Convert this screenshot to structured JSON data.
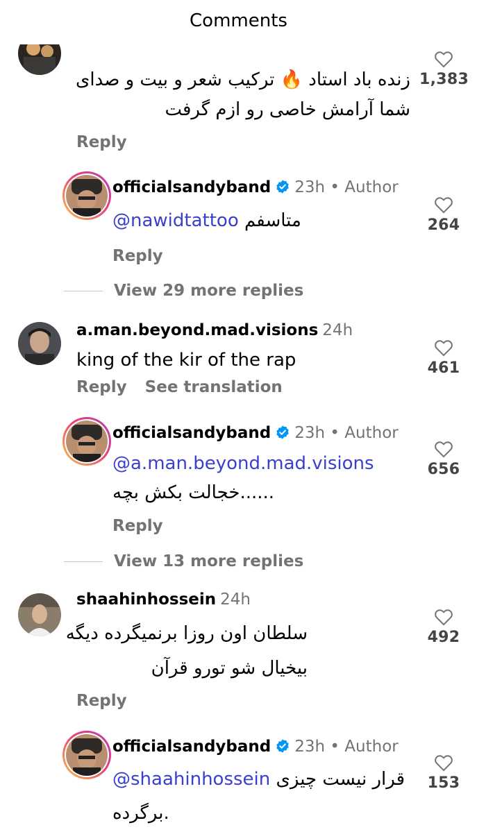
{
  "header": {
    "title": "Comments"
  },
  "comments": [
    {
      "text_line1": "زنده باد استاد 🔥 ترکیب شعر و بیت و صدای",
      "text_line2": "شما آرامش خاصی رو ازم گرفت",
      "reply_label": "Reply",
      "likes": "1,383"
    },
    {
      "username": "officialsandyband",
      "time": "23h • Author",
      "mention": "@nawidtattoo",
      "text": "متاسفم",
      "reply_label": "Reply",
      "likes": "264"
    },
    {
      "view_more": "View 29 more replies"
    },
    {
      "username": "a.man.beyond.mad.visions",
      "time": "24h",
      "text": "king of the kir of the rap",
      "reply_label": "Reply",
      "translate_label": "See translation",
      "likes": "461"
    },
    {
      "username": "officialsandyband",
      "time": "23h • Author",
      "mention": "@a.man.beyond.mad.visions",
      "text": "......خجالت بکش بچه",
      "reply_label": "Reply",
      "likes": "656"
    },
    {
      "view_more": "View 13 more replies"
    },
    {
      "username": "shaahinhossein",
      "time": "24h",
      "text_line1": "سلطان اون روزا برنمیگرده دیگه",
      "text_line2": "بیخیال شو تورو قرآن",
      "reply_label": "Reply",
      "likes": "492"
    },
    {
      "username": "officialsandyband",
      "time": "23h • Author",
      "mention": "@shaahinhossein",
      "text_line1": "قرار نیست چیزی",
      "text_line2": ".برگرده",
      "likes": "153"
    }
  ],
  "colors": {
    "mention": "#3b3fce",
    "verified": "#0095f6",
    "secondary_text": "#737373"
  }
}
